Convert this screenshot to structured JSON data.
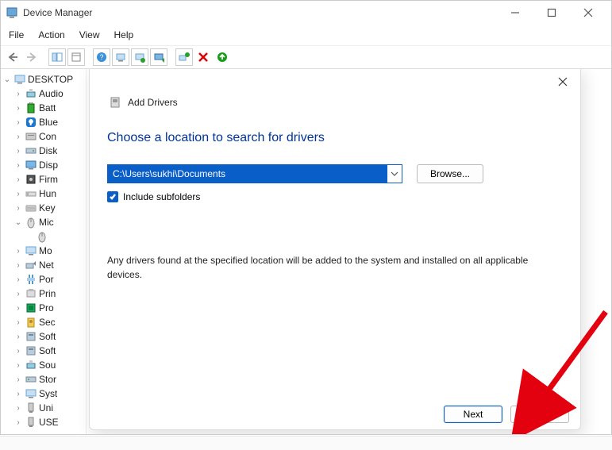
{
  "titlebar": {
    "title": "Device Manager"
  },
  "menubar": {
    "file": "File",
    "action": "Action",
    "view": "View",
    "help": "Help"
  },
  "tree": {
    "root": "DESKTOP",
    "items": [
      {
        "label": "Audio"
      },
      {
        "label": "Batt"
      },
      {
        "label": "Blue"
      },
      {
        "label": "Con"
      },
      {
        "label": "Disk"
      },
      {
        "label": "Disp"
      },
      {
        "label": "Firm"
      },
      {
        "label": "Hun"
      },
      {
        "label": "Key"
      },
      {
        "label": "Mic",
        "expanded": true,
        "child": ""
      },
      {
        "label": "Mo"
      },
      {
        "label": "Net"
      },
      {
        "label": "Por"
      },
      {
        "label": "Prin"
      },
      {
        "label": "Pro"
      },
      {
        "label": "Sec"
      },
      {
        "label": "Soft"
      },
      {
        "label": "Soft"
      },
      {
        "label": "Sou"
      },
      {
        "label": "Stor"
      },
      {
        "label": "Syst"
      },
      {
        "label": "Uni"
      },
      {
        "label": "USE"
      }
    ]
  },
  "dialog": {
    "header": "Add Drivers",
    "title": "Choose a location to search for drivers",
    "path": "C:\\Users\\sukhi\\Documents",
    "browse": "Browse...",
    "include_subfolders": "Include subfolders",
    "description": "Any drivers found at the specified location will be added to the system and installed on all applicable devices.",
    "next": "Next",
    "cancel": "Cancel"
  }
}
